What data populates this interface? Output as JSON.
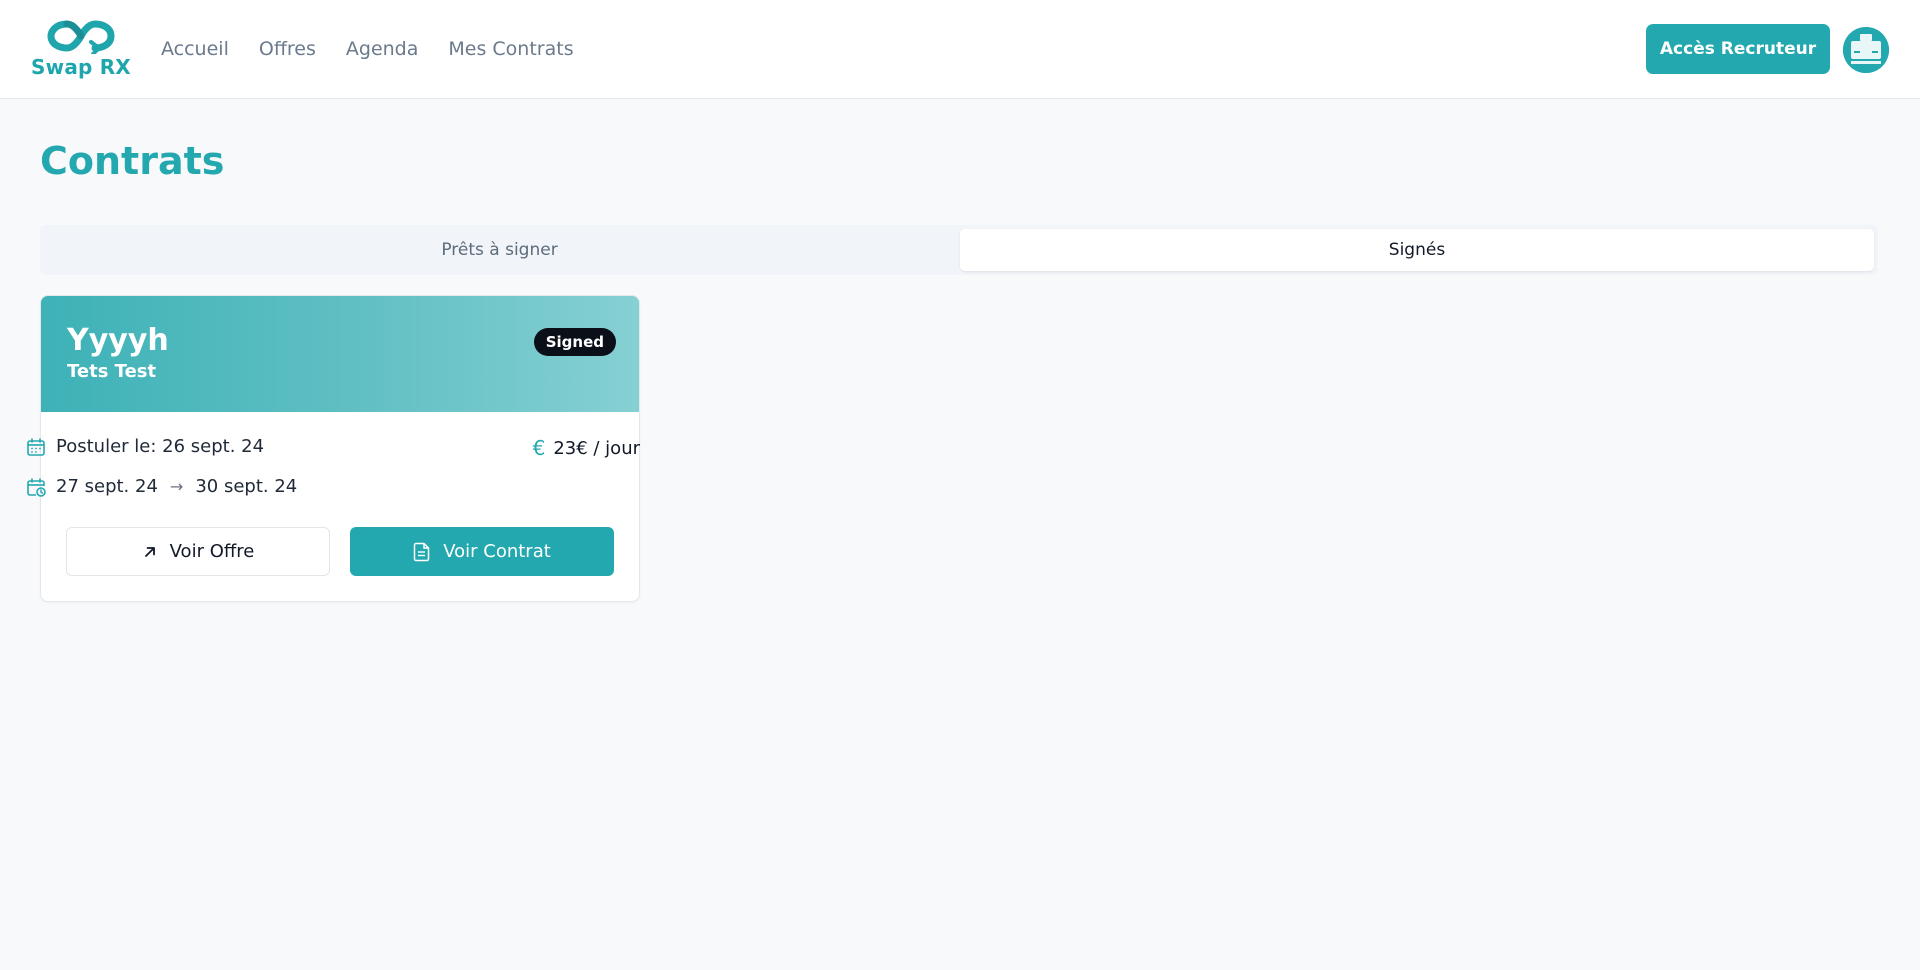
{
  "header": {
    "logo_text": "Swap RX",
    "nav": [
      "Accueil",
      "Offres",
      "Agenda",
      "Mes Contrats"
    ],
    "recruiter_button": "Accès Recruteur"
  },
  "page": {
    "title": "Contrats"
  },
  "tabs": {
    "ready": "Prêts à signer",
    "signed": "Signés",
    "active": "signed"
  },
  "contract_card": {
    "title": "Yyyyh",
    "subtitle": "Tets Test",
    "status": "Signed",
    "applied_label": "Postuler le: 26 sept. 24",
    "price_symbol": "€",
    "price": "23€ / jour",
    "start_date": "27 sept. 24",
    "end_date": "30 sept. 24",
    "view_offer": "Voir Offre",
    "view_contract": "Voir Contrat"
  },
  "colors": {
    "brand": "#22a8ae",
    "badge": "#0b0f17",
    "background": "#f8f9fb"
  }
}
